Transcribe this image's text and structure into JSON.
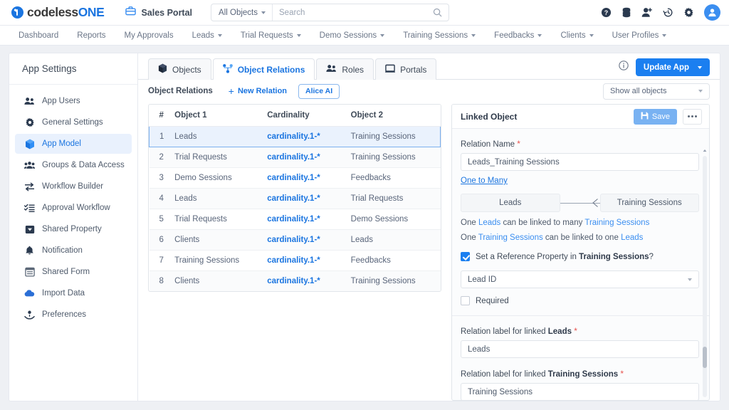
{
  "topbar": {
    "brand_dark": "codeless",
    "brand_blue": "ONE",
    "portal_label": "Sales Portal",
    "search_scope": "All Objects",
    "search_value": "",
    "search_placeholder": "Search",
    "icons": [
      "help-icon",
      "database-icon",
      "add-user-icon",
      "history-icon",
      "gear-icon",
      "avatar-icon"
    ]
  },
  "nav": {
    "items": [
      {
        "label": "Dashboard",
        "has_caret": false
      },
      {
        "label": "Reports",
        "has_caret": false
      },
      {
        "label": "My Approvals",
        "has_caret": false
      },
      {
        "label": "Leads",
        "has_caret": true
      },
      {
        "label": "Trial Requests",
        "has_caret": true
      },
      {
        "label": "Demo Sessions",
        "has_caret": true
      },
      {
        "label": "Training Sessions",
        "has_caret": true
      },
      {
        "label": "Feedbacks",
        "has_caret": true
      },
      {
        "label": "Clients",
        "has_caret": true
      },
      {
        "label": "User Profiles",
        "has_caret": true
      }
    ]
  },
  "sidebar": {
    "title": "App Settings",
    "items": [
      {
        "label": "App Users",
        "icon": "users-icon",
        "active": false
      },
      {
        "label": "General Settings",
        "icon": "gear-icon",
        "active": false
      },
      {
        "label": "App Model",
        "icon": "cube-icon",
        "active": true
      },
      {
        "label": "Groups & Data Access",
        "icon": "group-icon",
        "active": false
      },
      {
        "label": "Workflow Builder",
        "icon": "arrows-icon",
        "active": false
      },
      {
        "label": "Approval Workflow",
        "icon": "checklist-icon",
        "active": false
      },
      {
        "label": "Shared Property",
        "icon": "tag-icon",
        "active": false
      },
      {
        "label": "Notification",
        "icon": "bell-icon",
        "active": false
      },
      {
        "label": "Shared Form",
        "icon": "form-icon",
        "active": false
      },
      {
        "label": "Import Data",
        "icon": "cloud-upload-icon",
        "active": false
      },
      {
        "label": "Preferences",
        "icon": "preferences-icon",
        "active": false
      }
    ]
  },
  "tabs": [
    {
      "label": "Objects",
      "icon": "cube-icon",
      "active": false
    },
    {
      "label": "Object Relations",
      "icon": "relations-icon",
      "active": true
    },
    {
      "label": "Roles",
      "icon": "roles-icon",
      "active": false
    },
    {
      "label": "Portals",
      "icon": "portal-icon",
      "active": false
    }
  ],
  "toolbar": {
    "info_icon": "info-icon",
    "update_app_label": "Update App"
  },
  "subbar": {
    "title": "Object Relations",
    "new_relation_label": "New Relation",
    "alice_label": "Alice AI",
    "filter_value": "Show all objects"
  },
  "table": {
    "headers": [
      "#",
      "Object 1",
      "Cardinality",
      "Object 2"
    ],
    "rows": [
      {
        "num": "1",
        "object1": "Leads",
        "cardinality": "cardinality.1-*",
        "object2": "Training Sessions",
        "selected": true
      },
      {
        "num": "2",
        "object1": "Trial Requests",
        "cardinality": "cardinality.1-*",
        "object2": "Training Sessions",
        "selected": false
      },
      {
        "num": "3",
        "object1": "Demo Sessions",
        "cardinality": "cardinality.1-*",
        "object2": "Feedbacks",
        "selected": false
      },
      {
        "num": "4",
        "object1": "Leads",
        "cardinality": "cardinality.1-*",
        "object2": "Trial Requests",
        "selected": false
      },
      {
        "num": "5",
        "object1": "Trial Requests",
        "cardinality": "cardinality.1-*",
        "object2": "Demo Sessions",
        "selected": false
      },
      {
        "num": "6",
        "object1": "Clients",
        "cardinality": "cardinality.1-*",
        "object2": "Leads",
        "selected": false
      },
      {
        "num": "7",
        "object1": "Training Sessions",
        "cardinality": "cardinality.1-*",
        "object2": "Feedbacks",
        "selected": false
      },
      {
        "num": "8",
        "object1": "Clients",
        "cardinality": "cardinality.1-*",
        "object2": "Training Sessions",
        "selected": false
      }
    ]
  },
  "panel": {
    "title": "Linked Object",
    "save_label": "Save",
    "more_label": "...",
    "relation_name_label": "Relation Name",
    "relation_name_value": "Leads_Training Sessions",
    "relation_type_link": "One to Many",
    "viz_left": "Leads",
    "viz_right": "Training Sessions",
    "rule1_pre": "One ",
    "rule1_a": "Leads",
    "rule1_mid": " can be linked to many ",
    "rule1_b": "Training Sessions",
    "rule2_pre": "One ",
    "rule2_a": "Training Sessions",
    "rule2_mid": " can be linked to one ",
    "rule2_b": "Leads",
    "ref_prop_pre": "Set a Reference Property in ",
    "ref_prop_bold": "Training Sessions",
    "ref_prop_post": "?",
    "ref_prop_checked": true,
    "ref_prop_value": "Lead ID",
    "required_label": "Required",
    "required_checked": false,
    "label_left_pre": "Relation label for linked ",
    "label_left_bold": "Leads",
    "label_left_value": "Leads",
    "label_right_pre": "Relation label for linked ",
    "label_right_bold": "Training Sessions",
    "label_right_value": "Training Sessions"
  },
  "colors": {
    "accent": "#1b75e0",
    "primary_button": "#1b7ff0",
    "save_button": "#79b2f2",
    "selected_row": "#eaf2fd",
    "required_star": "#e8534f",
    "body_bg": "#eef0f4"
  }
}
